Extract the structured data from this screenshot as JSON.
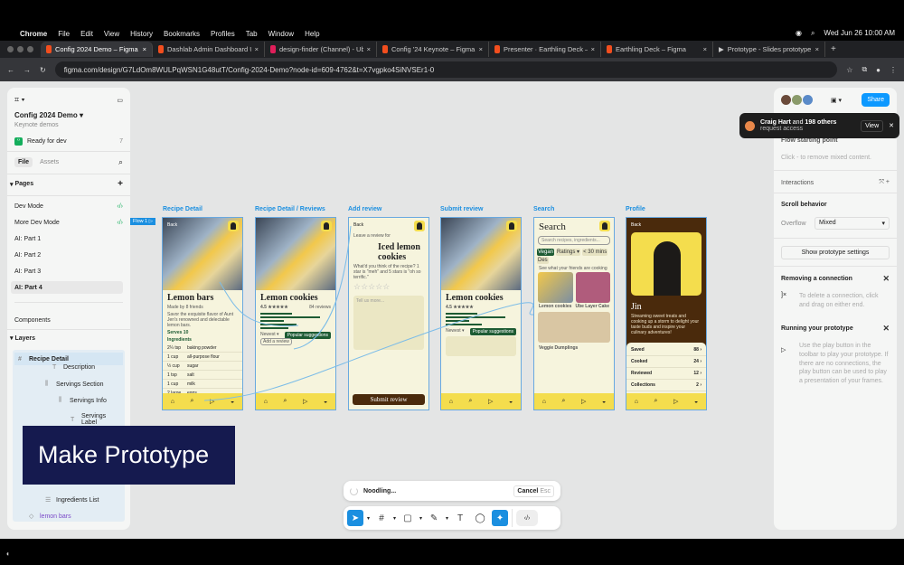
{
  "menubar": {
    "app": "Chrome",
    "items": [
      "File",
      "Edit",
      "View",
      "History",
      "Bookmarks",
      "Profiles",
      "Tab",
      "Window",
      "Help"
    ],
    "datetime": "Wed Jun 26  10:00 AM"
  },
  "tabs": [
    {
      "label": "Config 2024 Demo – Figma",
      "active": true
    },
    {
      "label": "Dashlab Admin Dashboard UI"
    },
    {
      "label": "design-finder (Channel) - Ub"
    },
    {
      "label": "Config '24 Keynote – Figma"
    },
    {
      "label": "Presenter · Earthling Deck – F"
    },
    {
      "label": "Earthling Deck – Figma"
    },
    {
      "label": "Prototype - Slides prototype"
    }
  ],
  "address": {
    "url": "figma.com/design/G7LdOm8WULPqWSN1G48utT/Config-2024-Demo?node-id=609-4762&t=X7vgpko4SiNVSEr1-0"
  },
  "left": {
    "file_name": "Config 2024 Demo",
    "team": "Keynote demos",
    "ready_for_dev": "Ready for dev",
    "ready_count": "7",
    "tab_file": "File",
    "tab_assets": "Assets",
    "pages_label": "Pages",
    "pages": [
      {
        "label": "Dev Mode",
        "dev": true
      },
      {
        "label": "More Dev Mode",
        "dev": true
      },
      {
        "label": "AI: Part 1"
      },
      {
        "label": "AI: Part 2"
      },
      {
        "label": "AI: Part 3"
      },
      {
        "label": "AI: Part 4",
        "selected": true
      }
    ],
    "components": "Components",
    "layers_label": "Layers",
    "layers": [
      {
        "label": "Recipe Detail",
        "icon": "frame"
      },
      {
        "label": "Description",
        "icon": "text"
      },
      {
        "label": "Servings Section",
        "icon": "autolayout"
      },
      {
        "label": "Servings Info",
        "icon": "autolayout"
      },
      {
        "label": "Servings Label",
        "icon": "text"
      },
      {
        "label": "Ingredients List",
        "icon": "list"
      },
      {
        "label": "lemon bars",
        "icon": "component"
      }
    ]
  },
  "overlay": {
    "title": "Make Prototype"
  },
  "frames": {
    "flow": "Flow 1",
    "recipe_detail": {
      "name": "Recipe Detail",
      "back": "Back",
      "tabs": [
        "Recipe",
        "Reviews"
      ],
      "title": "Lemon bars",
      "made_by": "Made by 8 friends",
      "desc": "Savor the exquisite flavor of Aunt Jen's renowned and delectable lemon bars.",
      "serves": "Serves 10",
      "ingredients_label": "Ingredients",
      "ingredients": [
        [
          "2¼ tsp",
          "baking powder"
        ],
        [
          "1 cup",
          "all-purpose flour"
        ],
        [
          "½ cup",
          "sugar"
        ],
        [
          "1 tsp",
          "salt"
        ],
        [
          "1 cup",
          "milk"
        ],
        [
          "2 large",
          "eggs"
        ],
        [
          "¼ cup",
          "vegetable oil"
        ]
      ]
    },
    "recipe_reviews": {
      "name": "Recipe Detail / Reviews",
      "title": "Lemon cookies",
      "rating": "4.5 ★★★★★",
      "reviews_count": "84 reviews",
      "sort": "Newest ▾",
      "popular": "Popular suggestions",
      "add_review": "Add a review"
    },
    "add_review": {
      "name": "Add review",
      "back": "Back",
      "leave": "Leave a review for",
      "recipe": "Iced lemon cookies",
      "question": "What'd you think of the recipe? 1 star is \"meh\" and 5 stars is \"oh so terrific.\"",
      "placeholder": "Tell us more...",
      "submit": "Submit review"
    },
    "submit_review": {
      "name": "Submit review",
      "title": "Lemon cookies",
      "rating": "4.5 ★★★★★",
      "sort": "Newest ▾",
      "popular": "Popular suggestions"
    },
    "search": {
      "name": "Search",
      "title": "Search",
      "placeholder": "Search recipes, ingredients...",
      "chips": [
        "Vegan",
        "Ratings ▾",
        "< 30 mins",
        "Des"
      ],
      "friends": "See what your friends are cooking",
      "items": [
        "Lemon cookies",
        "Ube Layer Cake",
        "Veggie Dumplings"
      ]
    },
    "profile": {
      "name": "Profile",
      "back": "Back",
      "person": "Jin",
      "bio": "Streaming sweet treats and cooking up a storm to delight your taste buds and inspire your culinary adventures!",
      "stats": [
        [
          "Saved",
          "88"
        ],
        [
          "Cooked",
          "24"
        ],
        [
          "Reviewed",
          "12"
        ],
        [
          "Collections",
          "2"
        ]
      ]
    }
  },
  "right": {
    "share": "Share",
    "toast_name": "Craig Hart",
    "toast_mid": " and ",
    "toast_count": "198 others",
    "toast_sub": "request access",
    "toast_view": "View",
    "flow_start": "Flow starting point",
    "mixed_hint": "Click - to remove mixed content.",
    "interactions": "Interactions",
    "scroll": "Scroll behavior",
    "overflow_label": "Overflow",
    "overflow_value": "Mixed",
    "show_settings": "Show prototype settings",
    "removing_title": "Removing a connection",
    "removing_text": "To delete a connection, click and drag on either end.",
    "running_title": "Running your prototype",
    "running_text": "Use the play button in the toolbar to play your prototype. If there are no connections, the play button can be used to play a presentation of your frames."
  },
  "status": {
    "text": "Noodling...",
    "cancel": "Cancel",
    "cancel_key": "Esc"
  },
  "colors": {
    "accent": "#1b8fe0",
    "overlay": "#151a4f",
    "recipe_green": "#1d5b33",
    "phone_yellow": "#f4dd4d",
    "profile_brown": "#4a2a0c"
  }
}
